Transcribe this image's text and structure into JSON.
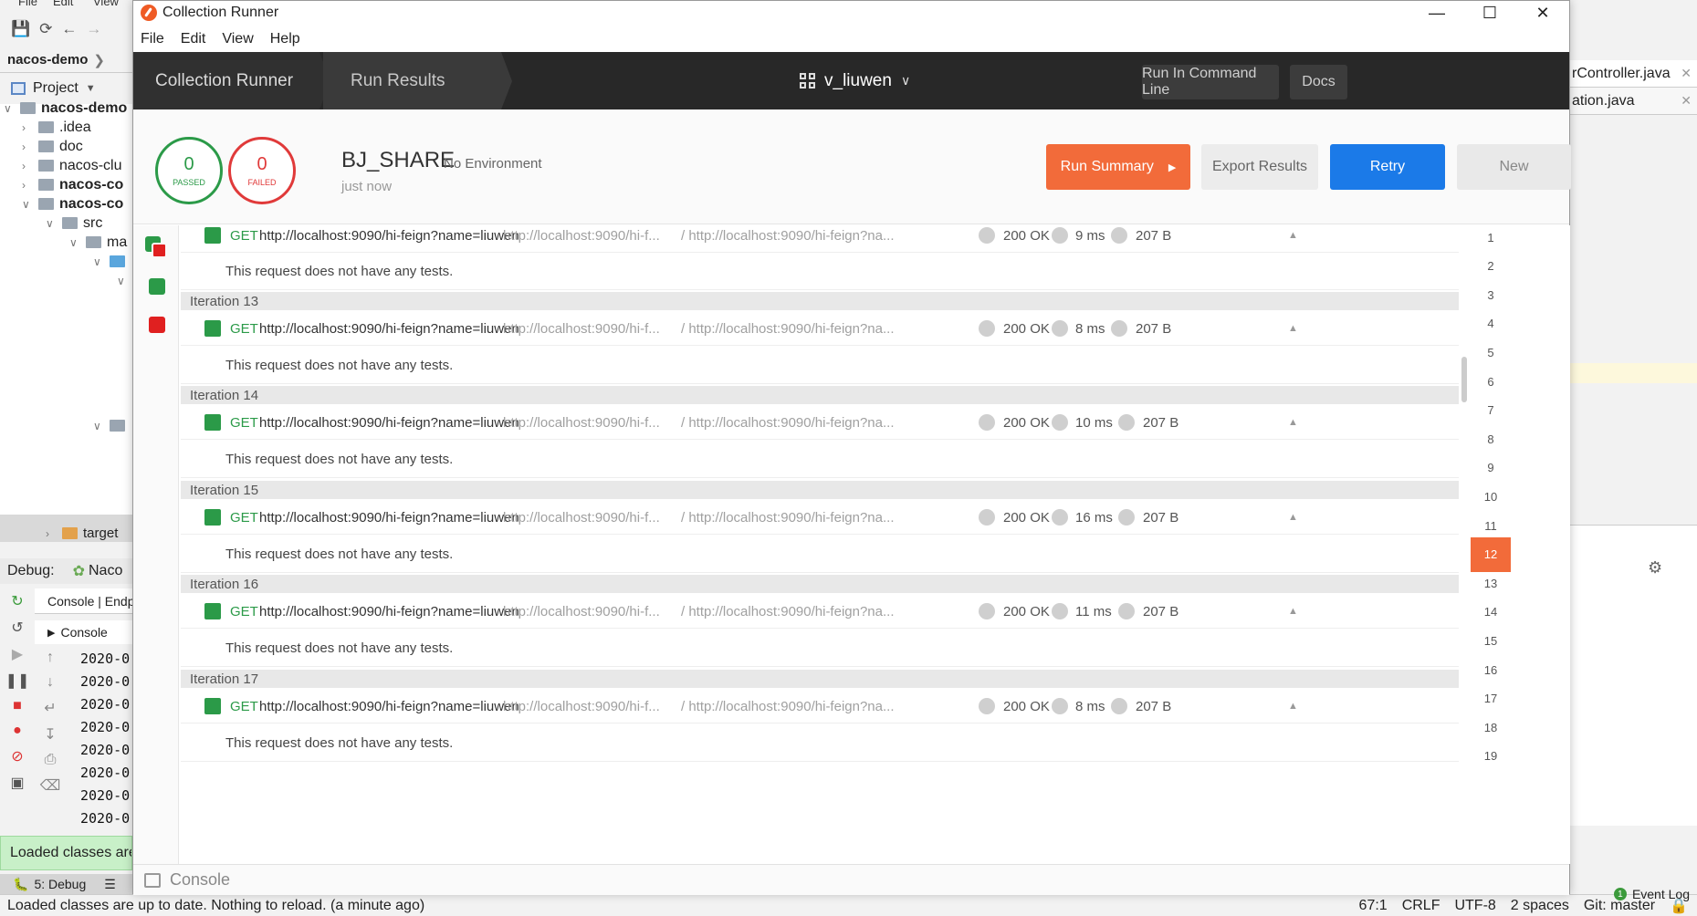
{
  "ide": {
    "menu": [
      "File",
      "Edit",
      "View"
    ],
    "breadcrumb": "nacos-demo",
    "project_label": "Project",
    "tree": [
      {
        "label": "nacos-demo",
        "bold": true
      },
      {
        "label": ".idea"
      },
      {
        "label": "doc"
      },
      {
        "label": "nacos-clu"
      },
      {
        "label": "nacos-co"
      },
      {
        "label": "nacos-co"
      },
      {
        "label": "src"
      },
      {
        "label": "ma"
      },
      {
        "label": "target"
      }
    ],
    "debug_label": "Debug:",
    "debug_config": "Naco",
    "debug_tabs": "Console | Endp",
    "console_tab": "Console",
    "console_lines": [
      "2020-0",
      "2020-0",
      "2020-0",
      "2020-0",
      "2020-0",
      "2020-0",
      "2020-0",
      "2020-0",
      "2020-0"
    ],
    "toast": "Loaded classes are",
    "debug_tool": "5: Debug",
    "status_message": "Loaded classes are up to date. Nothing to reload. (a minute ago)",
    "status_right": [
      "67:1",
      "CRLF",
      "UTF-8",
      "2 spaces",
      "Git: master"
    ],
    "right_tabs": [
      "rController.java",
      "ation.java"
    ],
    "event_log": "Event Log"
  },
  "window": {
    "title": "Collection Runner",
    "menu": [
      "File",
      "Edit",
      "View",
      "Help"
    ]
  },
  "nav": {
    "tab_runner": "Collection Runner",
    "tab_results": "Run Results",
    "workspace": "v_liuwen",
    "cmd_button": "Run In Command Line",
    "docs_button": "Docs"
  },
  "summary": {
    "passed_count": "0",
    "passed_label": "PASSED",
    "failed_count": "0",
    "failed_label": "FAILED",
    "collection": "BJ_SHARE",
    "environment": "No Environment",
    "time": "just now",
    "run_summary": "Run Summary",
    "export": "Export Results",
    "retry": "Retry",
    "new": "New"
  },
  "results": {
    "no_tests": "This request does not have any tests.",
    "requests": [
      {
        "iteration": "",
        "method": "GET",
        "url": "http://localhost:9090/hi-feign?name=liuwen",
        "url_short": "http://localhost:9090/hi-f...",
        "url_path": "/ http://localhost:9090/hi-feign?na...",
        "status": "200 OK",
        "time": "9 ms",
        "size": "207 B"
      },
      {
        "iteration": "Iteration 13",
        "method": "GET",
        "url": "http://localhost:9090/hi-feign?name=liuwen",
        "url_short": "http://localhost:9090/hi-f...",
        "url_path": "/ http://localhost:9090/hi-feign?na...",
        "status": "200 OK",
        "time": "8 ms",
        "size": "207 B"
      },
      {
        "iteration": "Iteration 14",
        "method": "GET",
        "url": "http://localhost:9090/hi-feign?name=liuwen",
        "url_short": "http://localhost:9090/hi-f...",
        "url_path": "/ http://localhost:9090/hi-feign?na...",
        "status": "200 OK",
        "time": "10 ms",
        "size": "207 B"
      },
      {
        "iteration": "Iteration 15",
        "method": "GET",
        "url": "http://localhost:9090/hi-feign?name=liuwen",
        "url_short": "http://localhost:9090/hi-f...",
        "url_path": "/ http://localhost:9090/hi-feign?na...",
        "status": "200 OK",
        "time": "16 ms",
        "size": "207 B"
      },
      {
        "iteration": "Iteration 16",
        "method": "GET",
        "url": "http://localhost:9090/hi-feign?name=liuwen",
        "url_short": "http://localhost:9090/hi-f...",
        "url_path": "/ http://localhost:9090/hi-feign?na...",
        "status": "200 OK",
        "time": "11 ms",
        "size": "207 B"
      },
      {
        "iteration": "Iteration 17",
        "method": "GET",
        "url": "http://localhost:9090/hi-feign?name=liuwen",
        "url_short": "http://localhost:9090/hi-f...",
        "url_path": "/ http://localhost:9090/hi-feign?na...",
        "status": "200 OK",
        "time": "8 ms",
        "size": "207 B"
      }
    ]
  },
  "iterations": {
    "numbers": [
      "1",
      "2",
      "3",
      "4",
      "5",
      "6",
      "7",
      "8",
      "9",
      "10",
      "11",
      "12",
      "13",
      "14",
      "15",
      "16",
      "17",
      "18",
      "19"
    ],
    "active": "12"
  },
  "console_label": "Console",
  "colors": {
    "passed": "#2b9a48",
    "failed": "#e03a3a",
    "run_summary": "#f26b3a",
    "retry": "#1b7ae8",
    "nav_bg": "#282828"
  }
}
